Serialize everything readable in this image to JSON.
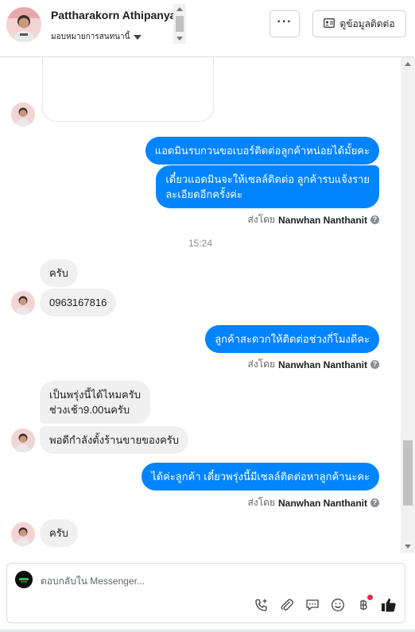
{
  "header": {
    "contact_name": "Pattharakorn Athipanya",
    "assign_label": "มอบหมายการสนทนานี้",
    "more_label": "···",
    "info_button_label": "ดูข้อมูลติดต่อ"
  },
  "messages": [
    {
      "side": "out",
      "text": "แอดมินรบกวนขอเบอร์ติดต่อลูกค้าหน่อยได้มั้ยคะ"
    },
    {
      "side": "out",
      "lines": [
        "เดี๋ยวแอดมินจะให้เซลล์ติดต่อ ลูกค้ารบแจ้งราย",
        "ละเอียดอีกครั้งค่ะ"
      ]
    },
    {
      "side": "in",
      "text": "ครับ"
    },
    {
      "side": "in",
      "text": "0963167816"
    },
    {
      "side": "out",
      "text": "ลูกค้าสะดวกให้ติดต่อช่วงกี่โมงดีคะ"
    },
    {
      "side": "in",
      "lines": [
        "เป็นพรุ่งนี้ได้ไหมครับ",
        "ช่วงเช้า9.00นครับ"
      ]
    },
    {
      "side": "in",
      "text": "พอดีกำลังตั้งร้านขายของครับ"
    },
    {
      "side": "out",
      "text": "ได้ค่ะลูกค้า เดี๋ยวพรุ่งนี้มีเซลล์ติดต่อหาลูกค้านะคะ"
    },
    {
      "side": "in",
      "text": "ครับ"
    }
  ],
  "sent_by": {
    "prefix": "ส่งโดย",
    "agent": "Nanwhan Nanthanit",
    "help_glyph": "?"
  },
  "timestamp": "15:24",
  "composer": {
    "placeholder": "ตอบกลับใน Messenger...",
    "tools": [
      "call-add-icon",
      "attachment-icon",
      "saved-replies-icon",
      "emoji-icon",
      "baht-payment-icon",
      "like-icon"
    ]
  },
  "colors": {
    "outgoing_bubble": "#0084ff",
    "incoming_bubble": "#f0f0f0",
    "like_icon": "#1c1e21",
    "notification_dot": "#f02849"
  }
}
